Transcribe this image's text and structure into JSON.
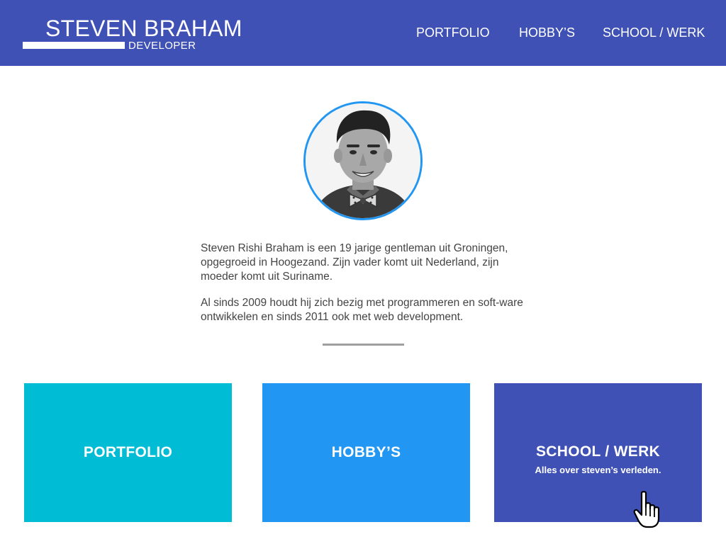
{
  "header": {
    "name": "STEVEN BRAHAM",
    "subtitle": "DEVELOPER",
    "nav": [
      {
        "label": "PORTFOLIO"
      },
      {
        "label": "HOBBY’S"
      },
      {
        "label": "SCHOOL / WERK"
      }
    ]
  },
  "profile": {
    "avatar_icon": "profile-photo",
    "bio": [
      "Steven Rishi Braham is een 19 jarige gentleman uit Groningen, opgegroeid in Hoogezand. Zijn vader komt uit Nederland, zijn moeder komt uit Suriname.",
      "Al sinds 2009 houdt hij zich bezig met programmeren en soft-ware ontwikkelen en sinds 2011 ook met web development."
    ]
  },
  "cards": [
    {
      "title": "PORTFOLIO",
      "color": "#00BCD4"
    },
    {
      "title": "HOBBY’S",
      "color": "#2196F3"
    },
    {
      "title": "SCHOOL / WERK",
      "subtitle": "Alles over steven’s verleden.",
      "color": "#3F51B5"
    }
  ],
  "colors": {
    "primary": "#3F51B5",
    "accent_blue": "#2196F3",
    "accent_cyan": "#00BCD4"
  }
}
